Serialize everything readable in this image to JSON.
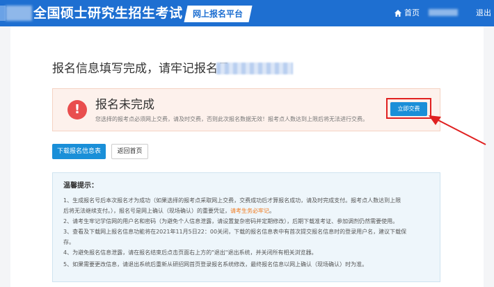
{
  "header": {
    "title": "全国硕士研究生招生考试",
    "platform": "网上报名平台",
    "home_label": "首页",
    "logout_label": "退出",
    "home_icon": "home-icon"
  },
  "main": {
    "done_message": "报名信息填写完成，请牢记报名号：",
    "alert": {
      "icon": "exclamation-icon",
      "title": "报名未完成",
      "description": "您选择的报考点必须网上交费，请及时交费，否则此次报名数据无效！报考点人数达到上限后将无法进行交费。",
      "pay_button": "立即交费"
    },
    "download_button": "下载报名信息表",
    "back_button": "返回首页"
  },
  "tips": {
    "title": "温馨提示：",
    "line1": "1、生成报名号后本次报名才为成功（如果选择的报考点采取网上交费，交费成功后才算报名成功，请及时完成支付。报考点人数达到上限",
    "line2_a": "后将无法继续支付。），报名号是网上确认（现场确认）的重要凭证，",
    "line2_highlight": "请考生务必牢记",
    "line2_b": "。",
    "line3": "2、请考生牢记学信网的用户名和密码（为避免个人信息泄露，请设置复杂密码并定期修改），后期下载准考证、参加调剂仍然需要使用。",
    "line4": "3、查看及下载网上报名信息功能将在2021年11月5日22：00关闭，下载的报名信息表中有首次提交报名信息时的登录用户名，建议下载保",
    "line5": "存。",
    "line6": "4、为避免报名信息泄露，请在报名结束后点击页面右上方的\"退出\"退出系统，并关闭所有相关浏览器。",
    "line7": "5、如果需要更改信息，请退出系统后重新从研招网首页登录报名系统修改，最终报名信息以网上确认（现场确认）时为准。"
  },
  "colors": {
    "header_bg": "#1e6fd1",
    "primary": "#1a8fd8",
    "alert_icon": "#e94e4e",
    "highlight": "#f07a1e",
    "annotation": "#e02020"
  }
}
